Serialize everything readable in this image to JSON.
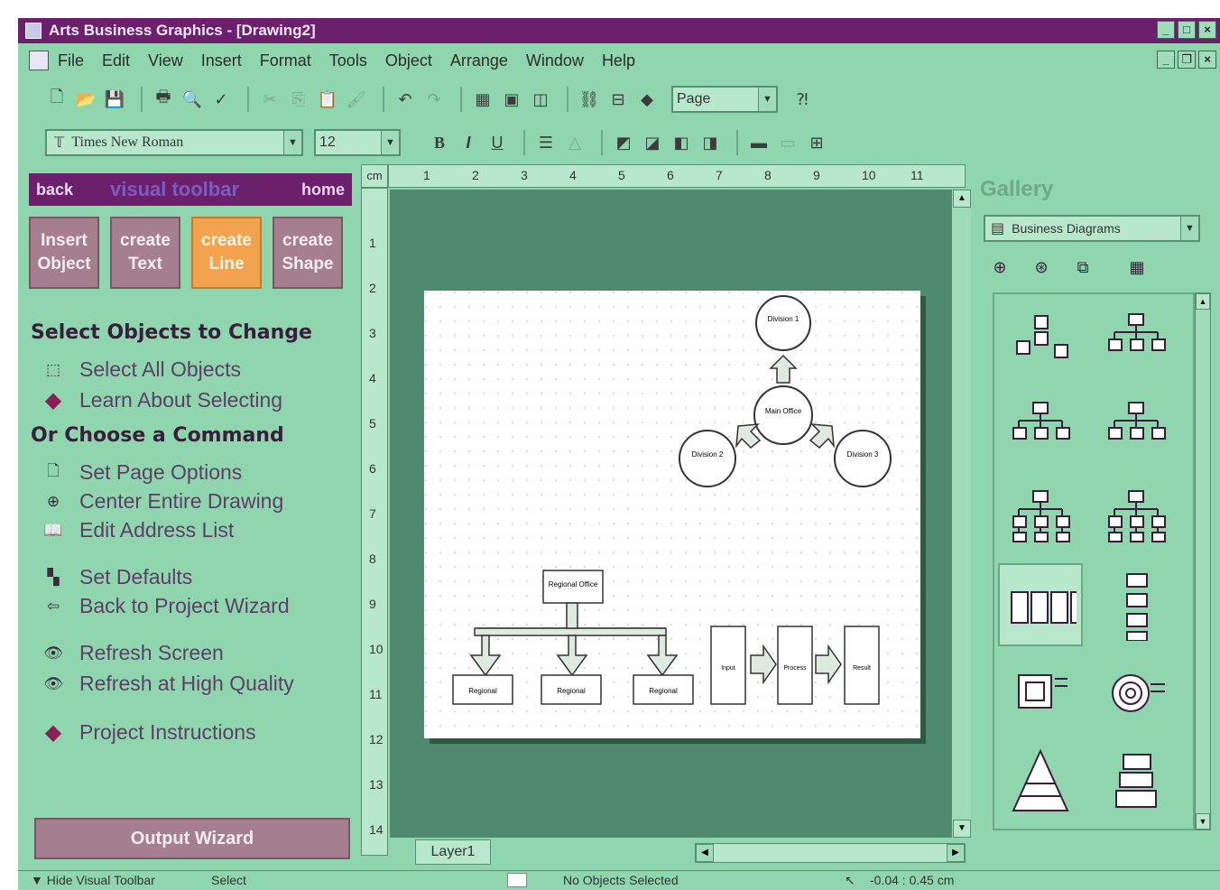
{
  "window": {
    "title": "Arts Business Graphics - [Drawing2]"
  },
  "menu": [
    "File",
    "Edit",
    "View",
    "Insert",
    "Format",
    "Tools",
    "Object",
    "Arrange",
    "Window",
    "Help"
  ],
  "toolbar": {
    "zoom_value": "Page",
    "font_name": "Times New Roman",
    "font_size": "12",
    "bold_label": "B",
    "italic_label": "I",
    "underline_label": "U"
  },
  "visual_toolbar": {
    "back_label": "back",
    "title": "visual toolbar",
    "home_label": "home",
    "buttons": [
      {
        "line1": "Insert",
        "line2": "Object"
      },
      {
        "line1": "create",
        "line2": "Text"
      },
      {
        "line1": "create",
        "line2": "Line"
      },
      {
        "line1": "create",
        "line2": "Shape"
      }
    ],
    "section1_title": "Select Objects to Change",
    "section1_items": [
      "Select All Objects",
      "Learn About Selecting"
    ],
    "section2_title": "Or Choose a Command",
    "section2_items": [
      "Set Page Options",
      "Center Entire Drawing",
      "Edit Address List",
      "Set Defaults",
      "Back to Project Wizard",
      "Refresh Screen",
      "Refresh at High Quality",
      "Project Instructions"
    ],
    "output_wizard_label": "Output Wizard"
  },
  "ruler": {
    "unit": "cm",
    "h_ticks": [
      "1",
      "2",
      "3",
      "4",
      "5",
      "6",
      "7",
      "8",
      "9",
      "10",
      "11"
    ],
    "v_ticks": [
      "1",
      "2",
      "3",
      "4",
      "5",
      "6",
      "7",
      "8",
      "9",
      "10",
      "11",
      "12",
      "13",
      "14"
    ]
  },
  "drawing": {
    "nodes": [
      {
        "label": "Division 1"
      },
      {
        "label": "Main Office"
      },
      {
        "label": "Division 2"
      },
      {
        "label": "Division 3"
      },
      {
        "label": "Regional Office"
      },
      {
        "label": "Regional"
      },
      {
        "label": "Regional"
      },
      {
        "label": "Regional"
      },
      {
        "label": "Input"
      },
      {
        "label": "Process"
      },
      {
        "label": "Result"
      }
    ]
  },
  "layer_tab": "Layer1",
  "gallery": {
    "title": "Gallery",
    "category": "Business Diagrams",
    "items": [
      "org-chart-boxes",
      "org-chart-small",
      "org-chart-medium",
      "org-chart-wide",
      "org-chart-tree",
      "org-chart-branch",
      "process-flow",
      "vertical-flow",
      "target-box",
      "target-circle",
      "pyramid",
      "stacked-list"
    ]
  },
  "status": {
    "hide_toolbar_label": "Hide Visual Toolbar",
    "mode": "Select",
    "selection": "No Objects Selected",
    "coordinates": "-0.04 : 0.45 cm"
  },
  "colors": {
    "background": "#8fd6ae",
    "titlebar": "#6c1f6a",
    "button": "#a67f8f",
    "active_button": "#f3a24e",
    "workspace": "#4f8a6f"
  }
}
